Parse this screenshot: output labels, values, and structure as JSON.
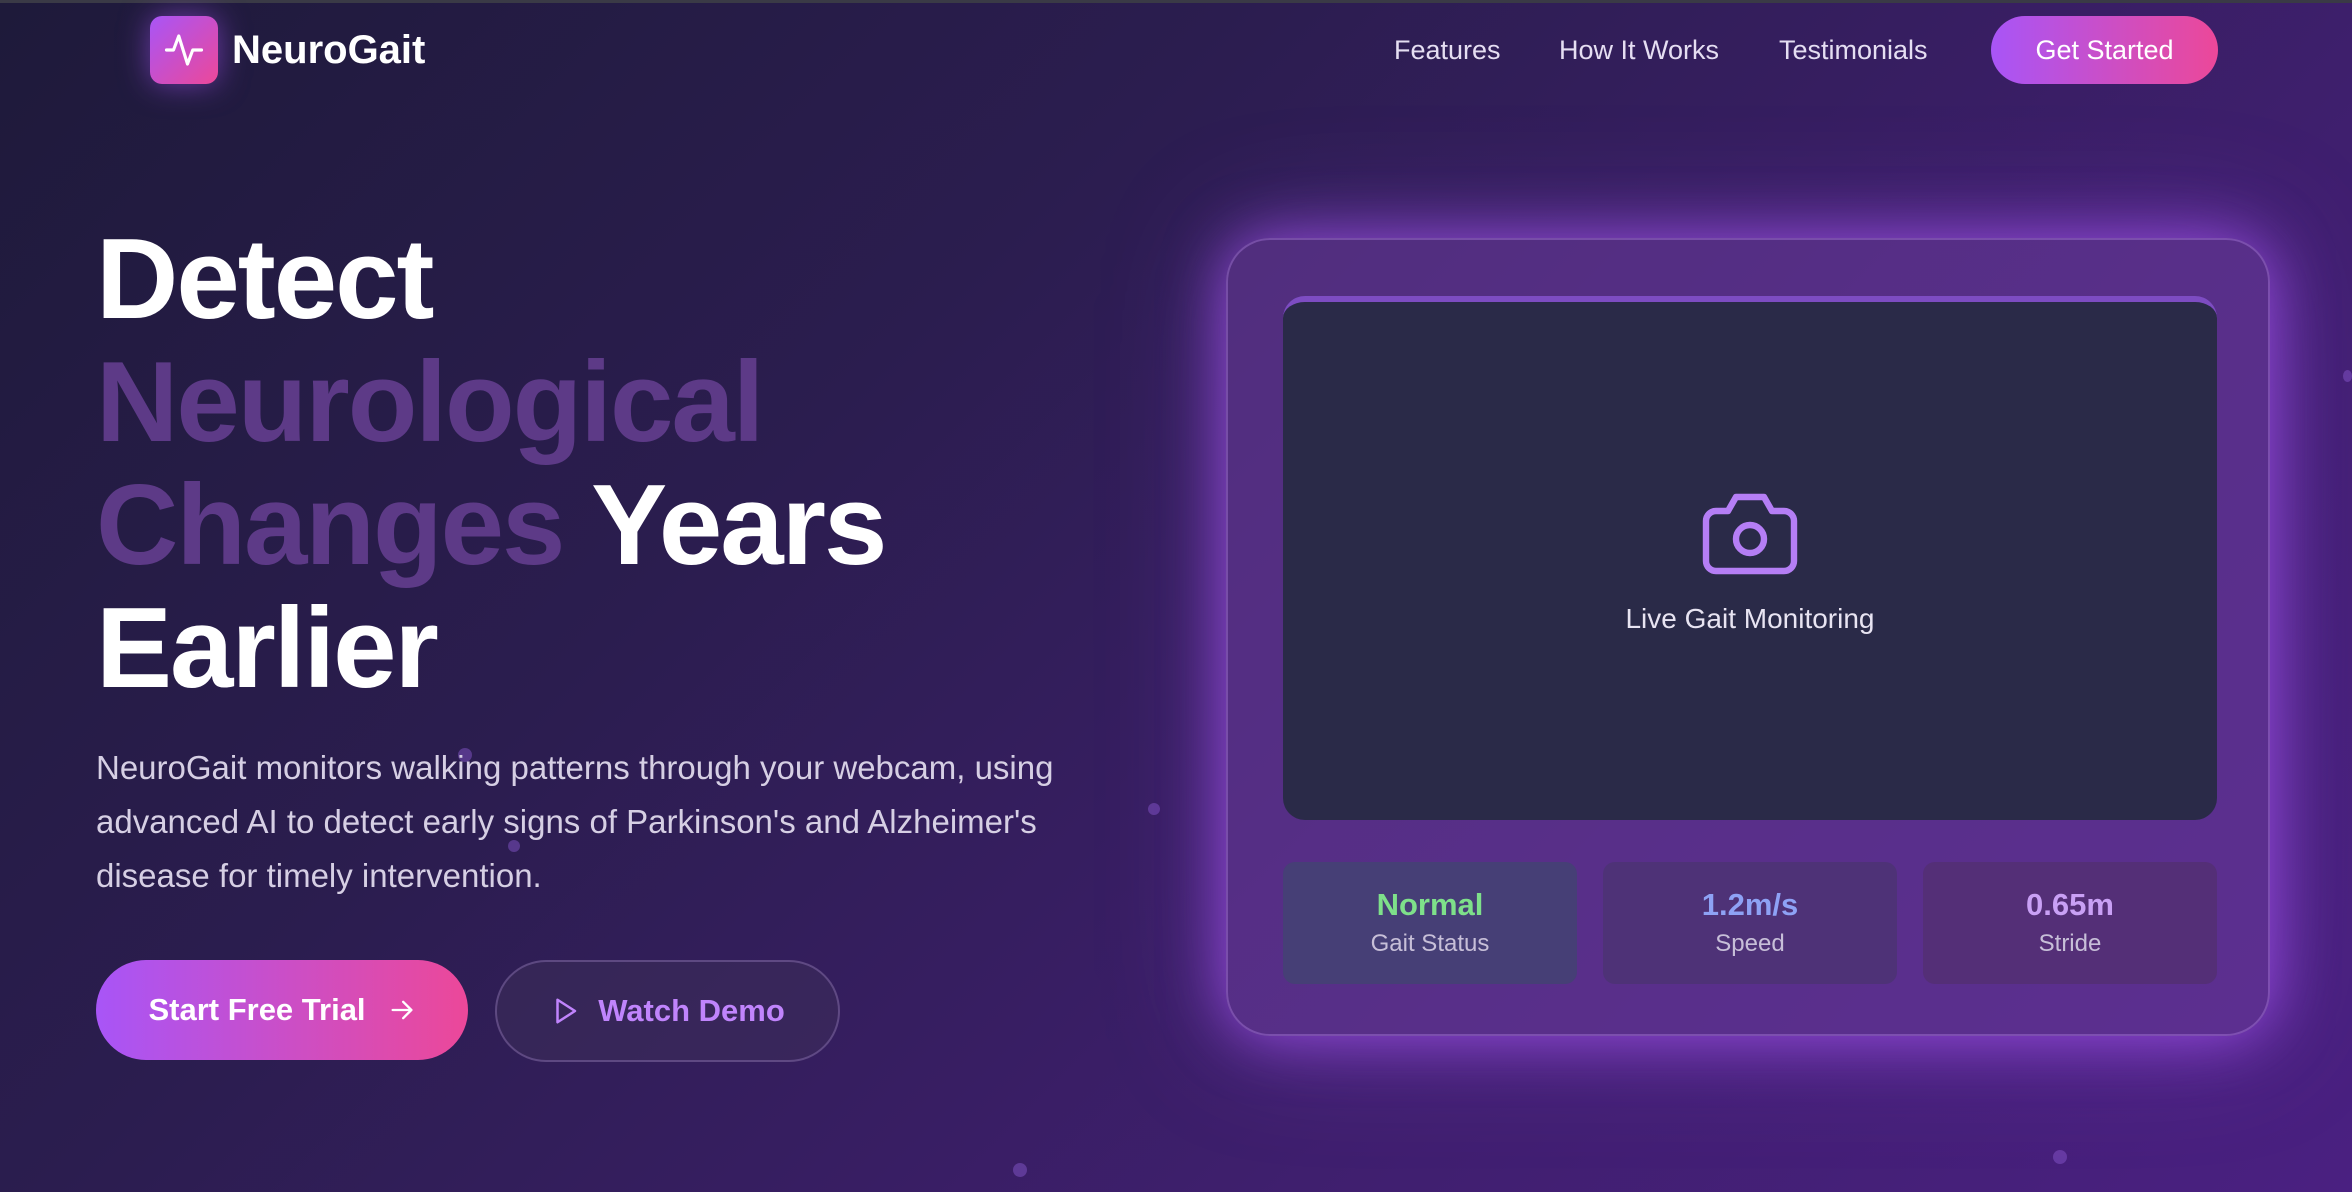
{
  "nav": {
    "brand": "NeuroGait",
    "links": [
      "Features",
      "How It Works",
      "Testimonials"
    ],
    "cta": "Get Started"
  },
  "hero": {
    "title": {
      "line1": "Detect",
      "line2": "Neurological",
      "line3a": "Changes",
      "line3b": "Years",
      "line4": "Earlier"
    },
    "description": "NeuroGait monitors walking patterns through your webcam, using advanced AI to detect early signs of Parkinson's and Alzheimer's disease for timely intervention.",
    "primary_button": "Start Free Trial",
    "secondary_button": "Watch Demo"
  },
  "monitor": {
    "video_label": "Live Gait Monitoring",
    "stats": [
      {
        "value": "Normal",
        "label": "Gait Status",
        "color": "#7ee08a"
      },
      {
        "value": "1.2m/s",
        "label": "Speed",
        "color": "#8ea2f5"
      },
      {
        "value": "0.65m",
        "label": "Stride",
        "color": "#c9a0f5"
      }
    ]
  },
  "icons": {
    "logo": "pulse-icon",
    "camera": "camera-icon",
    "arrow": "arrow-right-icon",
    "play": "play-icon"
  },
  "colors": {
    "accent_start": "#a855f7",
    "accent_end": "#ec4899",
    "background": "#2b1d4f"
  }
}
